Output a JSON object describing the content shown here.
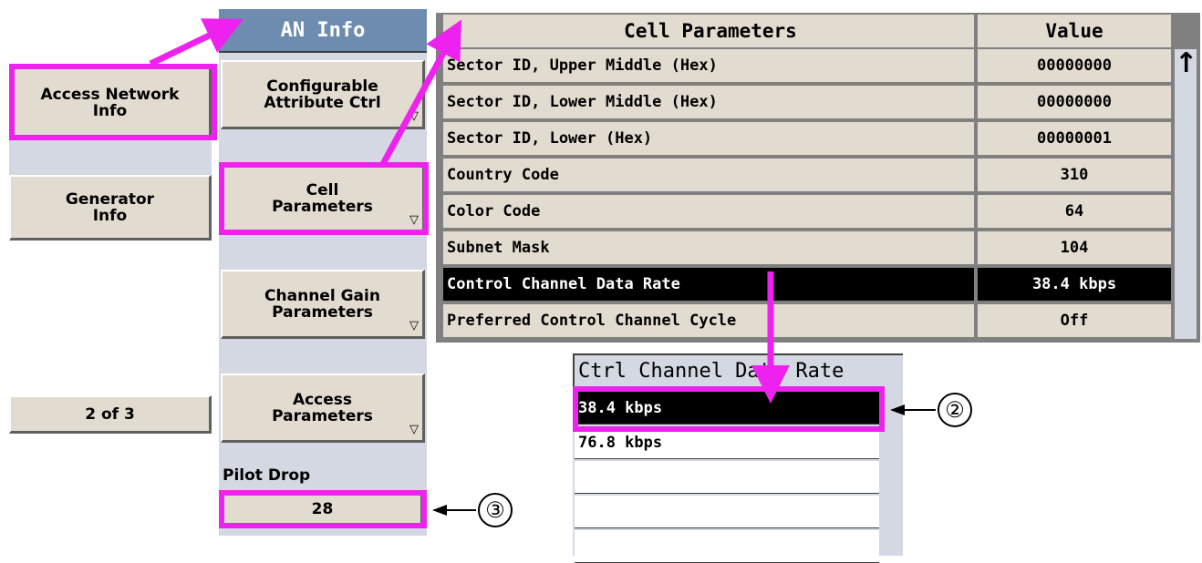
{
  "left_panel": {
    "buttons": [
      {
        "label": "Access Network\nInfo"
      },
      {
        "label": "Generator\nInfo"
      }
    ],
    "page_indicator": "2 of 3"
  },
  "mid_panel": {
    "title": "AN Info",
    "buttons": [
      {
        "label": "Configurable\nAttribute Ctrl"
      },
      {
        "label": "Cell\nParameters"
      },
      {
        "label": "Channel Gain\nParameters"
      },
      {
        "label": "Access\nParameters"
      }
    ],
    "pilot_drop_label": "Pilot Drop",
    "pilot_drop_value": "28"
  },
  "table": {
    "header_param": "Cell Parameters",
    "header_value": "Value",
    "rows": [
      {
        "name": "Sector ID, Upper Middle (Hex)",
        "value": "00000000"
      },
      {
        "name": "Sector ID, Lower Middle (Hex)",
        "value": "00000000"
      },
      {
        "name": "Sector ID, Lower (Hex)",
        "value": "00000001"
      },
      {
        "name": "Country Code",
        "value": "310"
      },
      {
        "name": "Color Code",
        "value": "64"
      },
      {
        "name": "Subnet Mask",
        "value": "104"
      },
      {
        "name": "Control Channel Data Rate",
        "value": "38.4 kbps"
      },
      {
        "name": "Preferred Control Channel Cycle",
        "value": "Off"
      }
    ],
    "scroll_arrow": "↑"
  },
  "dropdown": {
    "title": "Ctrl Channel Data Rate",
    "options": [
      "38.4 kbps",
      "76.8 kbps",
      "",
      "",
      ""
    ]
  },
  "callouts": {
    "two": "②",
    "three": "③"
  },
  "colors": {
    "highlight": "#ee22ee",
    "header_blue": "#6e8cb0",
    "button_bg": "#e2dbd0",
    "panel_bg": "#d4d8e2"
  }
}
